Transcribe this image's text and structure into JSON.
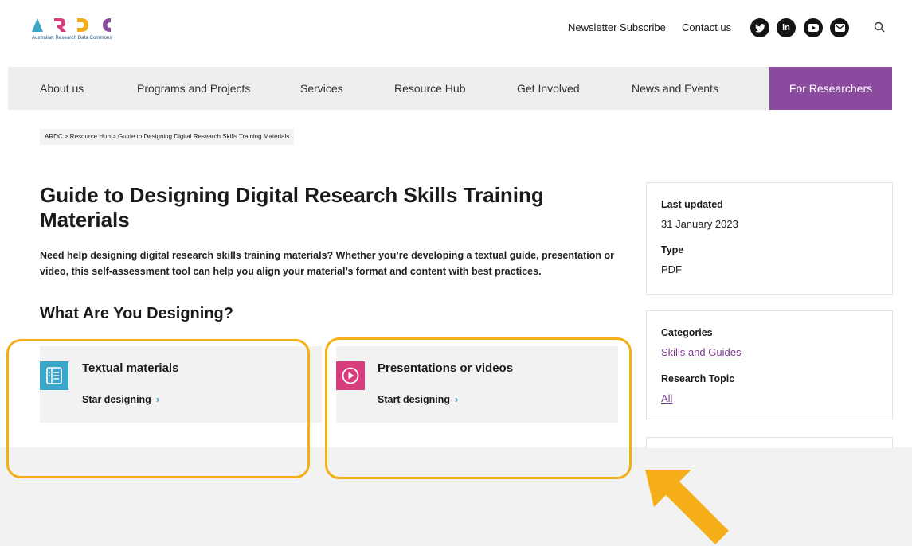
{
  "header": {
    "logo_tagline": "Australian Research Data Commons",
    "newsletter_label": "Newsletter Subscribe",
    "contact_label": "Contact us",
    "social_icons": [
      "twitter-icon",
      "linkedin-icon",
      "youtube-icon",
      "email-icon"
    ],
    "linkedin_text": "in"
  },
  "nav": {
    "items": [
      "About us",
      "Programs and Projects",
      "Services",
      "Resource Hub",
      "Get Involved",
      "News and Events",
      "For Researchers"
    ],
    "active_color": "#8a4a9e"
  },
  "breadcrumb": "ARDC  >  Resource Hub  > Guide to Designing Digital Research Skills Training Materials",
  "main": {
    "title": "Guide to Designing Digital Research Skills Training Materials",
    "intro": "Need help designing digital research skills training materials? Whether you’re developing a textual guide, presentation or video, this self-assessment tool can help you align your material’s format and content with best practices.",
    "section_title": "What Are You Designing?",
    "cards": [
      {
        "title": "Textual materials",
        "action": "Star designing",
        "icon": "document-icon",
        "icon_color": "#3ba6c8"
      },
      {
        "title": "Presentations or videos",
        "action": "Start designing",
        "icon": "play-icon",
        "icon_color": "#d83d7e"
      }
    ]
  },
  "sidebar": {
    "last_updated_label": "Last updated",
    "last_updated_value": "31 January 2023",
    "type_label": "Type",
    "type_value": "PDF",
    "categories_label": "Categories",
    "categories_value": "Skills and Guides",
    "research_topic_label": "Research Topic",
    "research_topic_value": "All"
  },
  "annotation_color": "#f5ae17"
}
